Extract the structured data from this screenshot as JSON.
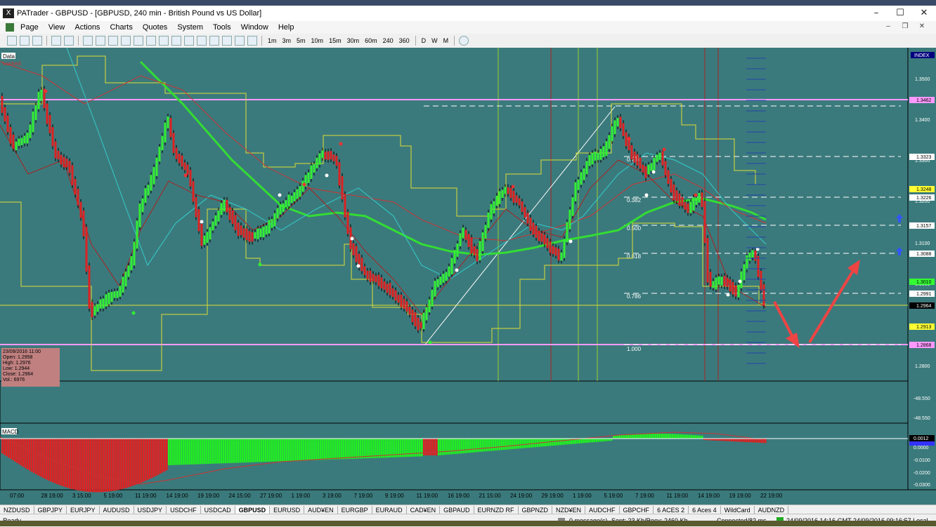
{
  "window": {
    "title": "PATrader - GBPUSD - [GBPUSD, 240 min - British Pound vs US Dollar]",
    "app_icon": "X"
  },
  "menu": [
    "Page",
    "View",
    "Actions",
    "Charts",
    "Quotes",
    "System",
    "Tools",
    "Window",
    "Help"
  ],
  "toolbar": {
    "timeframes": [
      "1m",
      "3m",
      "5m",
      "10m",
      "15m",
      "30m",
      "60m",
      "240",
      "360",
      "D",
      "W",
      "M"
    ]
  },
  "chart": {
    "labels": {
      "data": "Data",
      "locked": "Locked",
      "index": "INDEX",
      "macd": "MACD"
    },
    "price_axis": [
      "1.3500",
      "1.3400",
      "1.3300",
      "1.3200",
      "1.3100",
      "1.3000",
      "1.2900",
      "1.2800"
    ],
    "price_tags": [
      {
        "text": "1.3462",
        "color": "#ff99ff"
      },
      {
        "text": "1.3323",
        "color": "#ffffff"
      },
      {
        "text": "1.3248",
        "color": "#ffff33"
      },
      {
        "text": "1.3226",
        "color": "#ffffff"
      },
      {
        "text": "1.3157",
        "color": "#ffffff"
      },
      {
        "text": "1.3088",
        "color": "#ffffff"
      },
      {
        "text": "1.3010",
        "color": "#33ff33"
      },
      {
        "text": "1.2991",
        "color": "#ffffff"
      },
      {
        "text": "1.2964",
        "color": "#000000"
      },
      {
        "text": "1.2913",
        "color": "#ffff33"
      },
      {
        "text": "1.2868",
        "color": "#ff99ff"
      }
    ],
    "fib_levels": [
      "0.214",
      "0.382",
      "0.500",
      "0.618",
      "0.786",
      "1.000"
    ],
    "volume_axis": [
      "-48.550",
      "-48.550"
    ],
    "macd_axis": [
      "0.0000",
      "-0.0100",
      "-0.0200",
      "-0.0300"
    ],
    "macd_tag": "0.0012",
    "time_axis": [
      "07:00",
      "28 19:00",
      "3 15:00",
      "5 19:00",
      "11 19:00",
      "14 19:00",
      "19 19:00",
      "24 15:00",
      "27 19:00",
      "1 19:00",
      "3 19:00",
      "7 19:00",
      "9 19:00",
      "11 19:00",
      "16 19:00",
      "21 15:00",
      "24 19:00",
      "29 19:00",
      "1 19:00",
      "5 19:00",
      "7 19:00",
      "11 19:00",
      "14 19:00",
      "19 19:00",
      "22 19:00"
    ],
    "colors": {
      "background": "#3b7a7c",
      "bull": "#33ee33",
      "bear": "#dd2222",
      "support": "#ff99ff"
    }
  },
  "infobox": {
    "date": "23/09/2016 11:00",
    "open": "Open: 1.2958",
    "high": "High: 1.2976",
    "low": "Low: 1.2944",
    "close": "Close: 1.2964",
    "vol": "Vol.: 6976"
  },
  "tabs": [
    "NZDUSD",
    "GBPJPY",
    "EURJPY",
    "AUDUSD",
    "USDJPY",
    "USDCHF",
    "USDCAD",
    "GBPUSD",
    "EURUSD",
    "AUD¥EN",
    "EURGBP",
    "EURAUD",
    "CAD¥EN",
    "GBPAUD",
    "EURNZD RF",
    "GBPNZD",
    "NZD¥EN",
    "AUDCHF",
    "GBPCHF",
    "6 ACES 2",
    "6 Aces 4",
    "WildCard",
    "AUDNZD"
  ],
  "active_tab": "GBPUSD",
  "status": {
    "ready": "Ready",
    "messages": "0 message(s)",
    "sent": "Sent: 23 Kb/Recv: 2460 Kb",
    "connected": "Connected/82 ms",
    "gmt": "24/09/2016 14:16 GMT",
    "local": "24/09/2016 09:16:57 Local"
  }
}
